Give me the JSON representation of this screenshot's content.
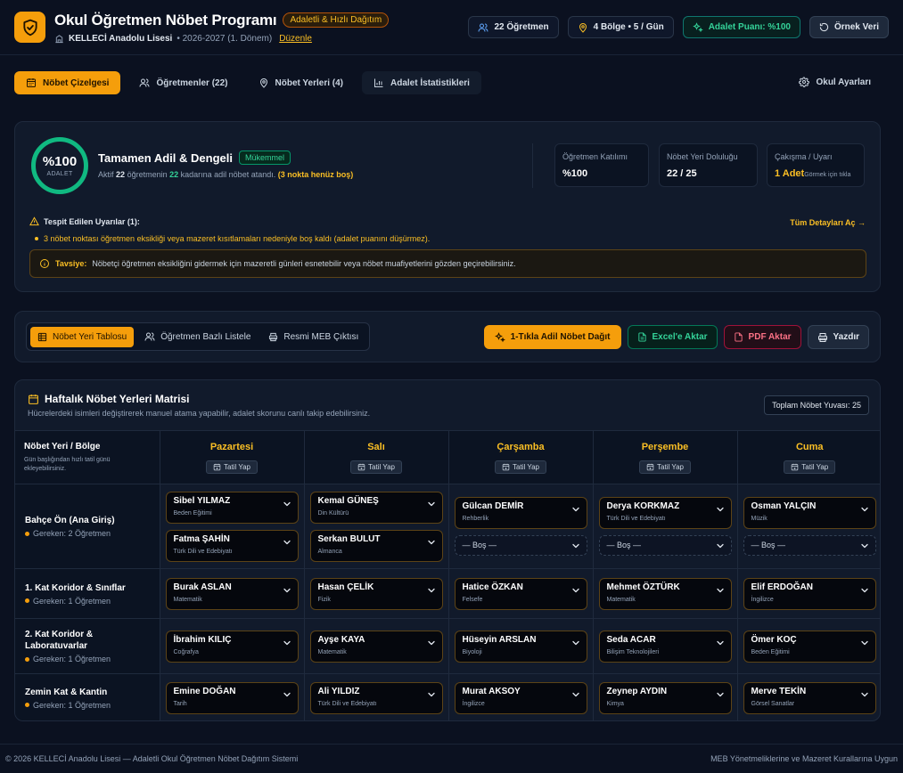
{
  "header": {
    "title": "Okul Öğretmen Nöbet Programı",
    "badge": "Adaletli & Hızlı Dağıtım",
    "school": "KELLECİ Anadolu Lisesi",
    "term": "• 2026-2027 (1. Dönem)",
    "edit": "Düzenle",
    "teachers": "22 Öğretmen",
    "zones": "4 Bölge • 5 / Gün",
    "fairness": "Adalet Puanı: %100",
    "sample": "Örnek Veri"
  },
  "tabs": {
    "schedule": "Nöbet Çizelgesi",
    "teachers": "Öğretmenler (22)",
    "locations": "Nöbet Yerleri (4)",
    "stats": "Adalet İstatistikleri",
    "settings": "Okul Ayarları"
  },
  "fairness_card": {
    "score": "%100",
    "score_label": "ADALET",
    "title": "Tamamen Adil & Dengeli",
    "badge": "Mükemmel",
    "desc_a": "Aktif",
    "desc_n1": "22",
    "desc_b": "öğretmenin",
    "desc_n2": "22",
    "desc_c": "kadarına adil nöbet atandı.",
    "desc_warn": "(3 nokta henüz boş)",
    "stats": [
      {
        "label": "Öğretmen Katılımı",
        "value": "%100"
      },
      {
        "label": "Nöbet Yeri Doluluğu",
        "value": "22 / 25"
      },
      {
        "label": "Çakışma / Uyarı",
        "value": "1 Adet",
        "sub": "Görmek için tıkla"
      }
    ],
    "warnings_title": "Tespit Edilen Uyarılar (1):",
    "details_link": "Tüm Detayları Aç →",
    "warning_item": "3 nöbet noktası öğretmen eksikliği veya mazeret kısıtlamaları nedeniyle boş kaldı (adalet puanını düşürmez).",
    "tip_label": "Tavsiye:",
    "tip_text": "Nöbetçi öğretmen eksikliğini gidermek için mazeretli günleri esnetebilir veya nöbet muafiyetlerini gözden geçirebilirsiniz."
  },
  "toolbar": {
    "view_table": "Nöbet Yeri Tablosu",
    "view_teacher": "Öğretmen Bazlı Listele",
    "view_official": "Resmi MEB Çıktısı",
    "distribute": "1-Tıkla Adil Nöbet Dağıt",
    "excel": "Excel'e Aktar",
    "pdf": "PDF Aktar",
    "print": "Yazdır"
  },
  "matrix": {
    "title": "Haftalık Nöbet Yerleri Matrisi",
    "subtitle": "Hücrelerdeki isimleri değiştirerek manuel atama yapabilir, adalet skorunu canlı takip edebilirsiniz.",
    "total": "Toplam Nöbet Yuvası: 25",
    "corner_title": "Nöbet Yeri / Bölge",
    "corner_sub": "Gün başlığından hızlı tatil günü ekleyebilirsiniz.",
    "holiday_label": "Tatil Yap",
    "empty_label": "— Boş —",
    "days": [
      "Pazartesi",
      "Salı",
      "Çarşamba",
      "Perşembe",
      "Cuma"
    ],
    "rows": [
      {
        "name": "Bahçe Ön (Ana Giriş)",
        "req": "Gereken: 2 Öğretmen",
        "cells": [
          [
            {
              "name": "Sibel YILMAZ",
              "subject": "Beden Eğitimi"
            },
            {
              "name": "Fatma ŞAHİN",
              "subject": "Türk Dili ve Edebiyatı"
            }
          ],
          [
            {
              "name": "Kemal GÜNEŞ",
              "subject": "Din Kültürü"
            },
            {
              "name": "Serkan BULUT",
              "subject": "Almanca"
            }
          ],
          [
            {
              "name": "Gülcan DEMİR",
              "subject": "Rehberlik"
            },
            {
              "name": "— Boş —",
              "subject": ""
            }
          ],
          [
            {
              "name": "Derya KORKMAZ",
              "subject": "Türk Dili ve Edebiyatı"
            },
            {
              "name": "— Boş —",
              "subject": ""
            }
          ],
          [
            {
              "name": "Osman YALÇIN",
              "subject": "Müzik"
            },
            {
              "name": "— Boş —",
              "subject": ""
            }
          ]
        ]
      },
      {
        "name": "1. Kat Koridor & Sınıflar",
        "req": "Gereken: 1 Öğretmen",
        "cells": [
          [
            {
              "name": "Burak ASLAN",
              "subject": "Matematik"
            }
          ],
          [
            {
              "name": "Hasan ÇELİK",
              "subject": "Fizik"
            }
          ],
          [
            {
              "name": "Hatice ÖZKAN",
              "subject": "Felsefe"
            }
          ],
          [
            {
              "name": "Mehmet ÖZTÜRK",
              "subject": "Matematik"
            }
          ],
          [
            {
              "name": "Elif ERDOĞAN",
              "subject": "İngilizce"
            }
          ]
        ]
      },
      {
        "name": "2. Kat Koridor & Laboratuvarlar",
        "req": "Gereken: 1 Öğretmen",
        "cells": [
          [
            {
              "name": "İbrahim KILIÇ",
              "subject": "Coğrafya"
            }
          ],
          [
            {
              "name": "Ayşe KAYA",
              "subject": "Matematik"
            }
          ],
          [
            {
              "name": "Hüseyin ARSLAN",
              "subject": "Biyoloji"
            }
          ],
          [
            {
              "name": "Seda ACAR",
              "subject": "Bilişim Teknolojileri"
            }
          ],
          [
            {
              "name": "Ömer KOÇ",
              "subject": "Beden Eğitimi"
            }
          ]
        ]
      },
      {
        "name": "Zemin Kat & Kantin",
        "req": "Gereken: 1 Öğretmen",
        "cells": [
          [
            {
              "name": "Emine DOĞAN",
              "subject": "Tarih"
            }
          ],
          [
            {
              "name": "Ali YILDIZ",
              "subject": "Türk Dili ve Edebiyatı"
            }
          ],
          [
            {
              "name": "Murat AKSOY",
              "subject": "İngilizce"
            }
          ],
          [
            {
              "name": "Zeynep AYDIN",
              "subject": "Kimya"
            }
          ],
          [
            {
              "name": "Merve TEKİN",
              "subject": "Görsel Sanatlar"
            }
          ]
        ]
      }
    ]
  },
  "footer": {
    "left": "© 2026 KELLECİ Anadolu Lisesi — Adaletli Okul Öğretmen Nöbet Dağıtım Sistemi",
    "right": "MEB Yönetmeliklerine ve Mazeret Kurallarına Uygun"
  },
  "colors": {
    "accent": "#f59e0b",
    "success": "#10b981",
    "background": "#0b1120",
    "card": "#111a2b"
  }
}
